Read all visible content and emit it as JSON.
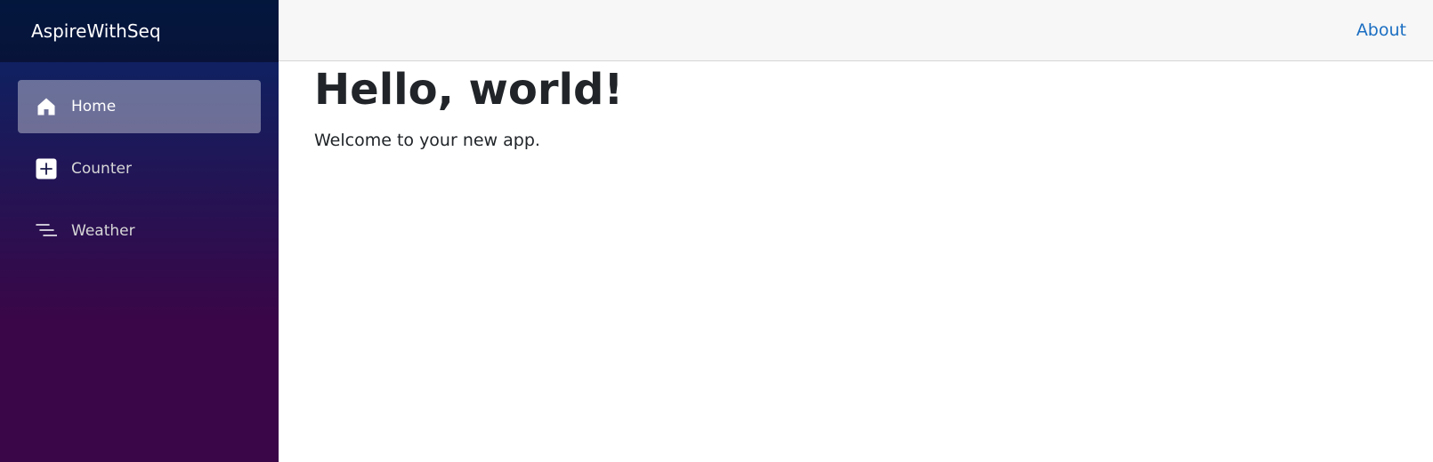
{
  "app": {
    "brand": "AspireWithSeq"
  },
  "sidebar": {
    "items": [
      {
        "label": "Home",
        "icon": "home-icon",
        "active": true
      },
      {
        "label": "Counter",
        "icon": "plus-square-icon",
        "active": false
      },
      {
        "label": "Weather",
        "icon": "list-icon",
        "active": false
      }
    ]
  },
  "header": {
    "about_label": "About"
  },
  "main": {
    "title": "Hello, world!",
    "welcome": "Welcome to your new app."
  },
  "colors": {
    "sidebar_top": "#052767",
    "sidebar_bottom": "#3a0647",
    "link": "#1b6ec2",
    "text": "#212529"
  }
}
